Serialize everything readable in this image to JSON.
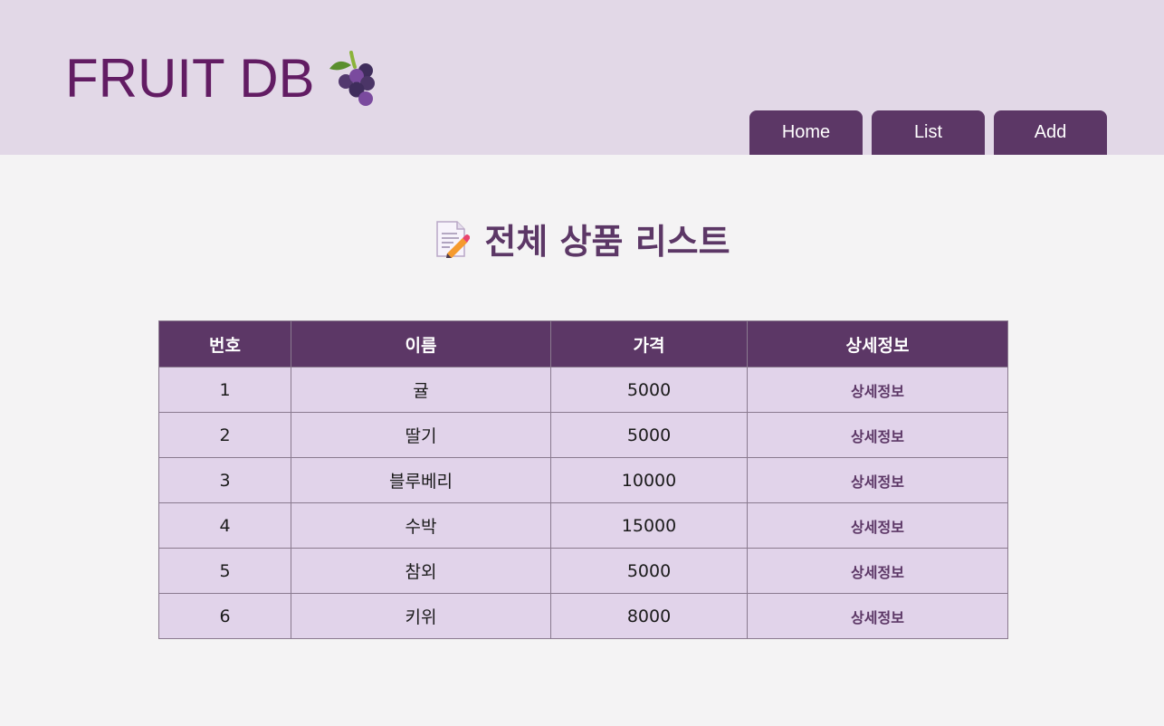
{
  "header": {
    "logo_text": "FRUIT DB",
    "logo_icon": "grape-icon"
  },
  "nav": {
    "home": "Home",
    "list": "List",
    "add": "Add"
  },
  "page": {
    "title": "전체 상품 리스트",
    "title_icon": "memo-icon"
  },
  "table": {
    "columns": [
      "번호",
      "이름",
      "가격",
      "상세정보"
    ],
    "rows": [
      {
        "no": "1",
        "name": "귤",
        "price": "5000",
        "detail": "상세정보"
      },
      {
        "no": "2",
        "name": "딸기",
        "price": "5000",
        "detail": "상세정보"
      },
      {
        "no": "3",
        "name": "블루베리",
        "price": "10000",
        "detail": "상세정보"
      },
      {
        "no": "4",
        "name": "수박",
        "price": "15000",
        "detail": "상세정보"
      },
      {
        "no": "5",
        "name": "참외",
        "price": "5000",
        "detail": "상세정보"
      },
      {
        "no": "6",
        "name": "키위",
        "price": "8000",
        "detail": "상세정보"
      }
    ]
  },
  "colors": {
    "header_bg": "#e2d8e7",
    "brand": "#621c63",
    "accent": "#5c3766",
    "row_bg": "#e1d3ea",
    "page_bg": "#f4f3f4"
  }
}
